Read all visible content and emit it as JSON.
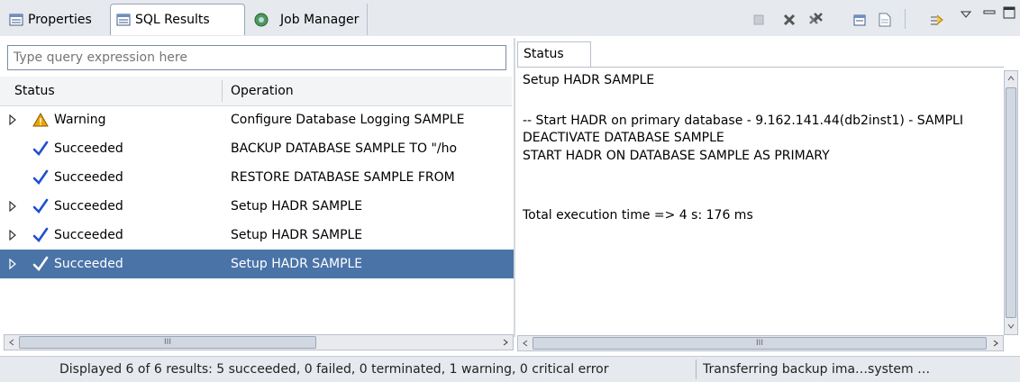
{
  "tabs": [
    {
      "label": "Properties",
      "icon": "properties-icon",
      "active": false
    },
    {
      "label": "SQL Results",
      "icon": "sql-results-icon",
      "active": true
    },
    {
      "label": "Job Manager",
      "icon": "job-manager-icon",
      "active": false
    }
  ],
  "toolbar": {
    "icons": [
      "stop-icon",
      "remove-icon",
      "remove-all-icon",
      "export-icon",
      "document-icon",
      "pin-icon",
      "view-menu-icon",
      "minimize-icon",
      "maximize-icon"
    ]
  },
  "search": {
    "value": "",
    "placeholder": "Type query expression here"
  },
  "table": {
    "headers": {
      "status": "Status",
      "operation": "Operation"
    },
    "rows": [
      {
        "status": "Warning",
        "operation": "Configure Database Logging SAMPLE",
        "icon": "warning-icon",
        "expandable": true,
        "selected": false
      },
      {
        "status": "Succeeded",
        "operation": "BACKUP DATABASE SAMPLE TO \"/ho",
        "icon": "checkmark-icon",
        "expandable": false,
        "selected": false
      },
      {
        "status": "Succeeded",
        "operation": "RESTORE DATABASE SAMPLE FROM",
        "icon": "checkmark-icon",
        "expandable": false,
        "selected": false
      },
      {
        "status": "Succeeded",
        "operation": "Setup HADR SAMPLE",
        "icon": "checkmark-icon",
        "expandable": true,
        "selected": false
      },
      {
        "status": "Succeeded",
        "operation": "Setup HADR SAMPLE",
        "icon": "checkmark-icon",
        "expandable": true,
        "selected": false
      },
      {
        "status": "Succeeded",
        "operation": "Setup HADR SAMPLE",
        "icon": "checkmark-icon",
        "expandable": true,
        "selected": true
      }
    ]
  },
  "detail": {
    "tab_label": "Status",
    "lines": [
      "Setup HADR SAMPLE",
      "-- Start HADR on primary database - 9.162.141.44(db2inst1) - SAMPLI",
      "DEACTIVATE DATABASE SAMPLE",
      "START HADR ON DATABASE SAMPLE AS PRIMARY",
      "Total execution time => 4 s: 176 ms"
    ]
  },
  "scrollbar_grip": "III",
  "status_bar": {
    "summary": "Displayed 6 of 6 results: 5 succeeded, 0 failed, 0 terminated, 1 warning, 0 critical error",
    "progress": "Transferring backup ima…system …"
  },
  "colors": {
    "selection": "#4a73a8",
    "check": "#1f4fd1",
    "warning": "#e8a400"
  }
}
